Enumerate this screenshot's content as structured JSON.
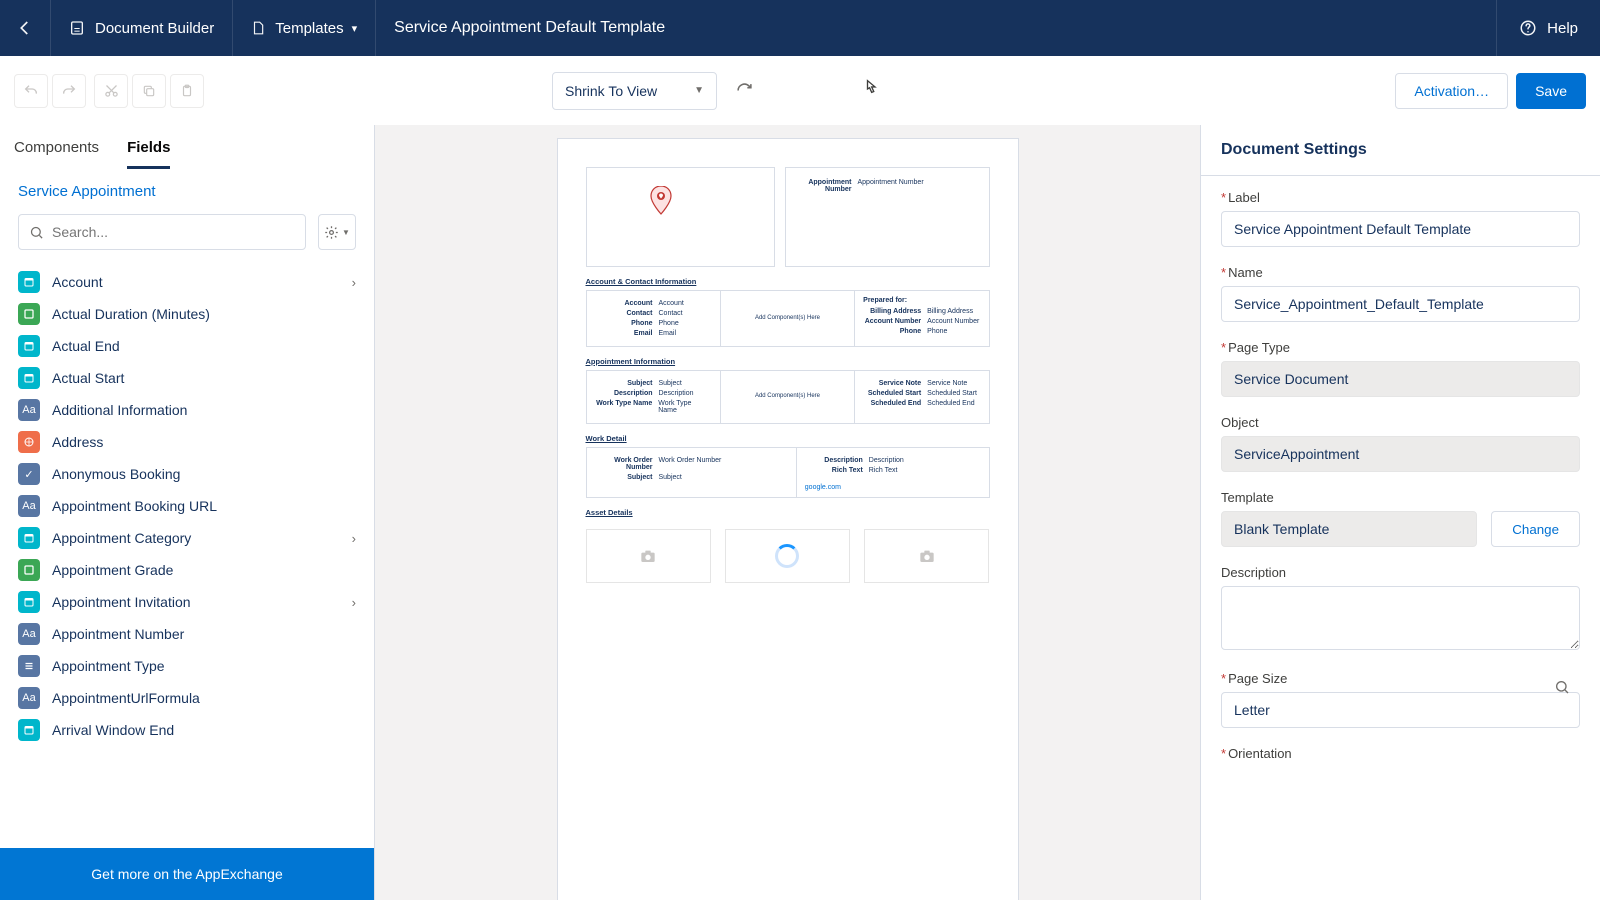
{
  "topbar": {
    "builder": "Document Builder",
    "templates": "Templates",
    "title": "Service Appointment Default Template",
    "help": "Help"
  },
  "toolbar": {
    "zoom": "Shrink To View",
    "activation": "Activation…",
    "save": "Save"
  },
  "left": {
    "tabs": {
      "components": "Components",
      "fields": "Fields"
    },
    "breadcrumb": "Service Appointment",
    "search_placeholder": "Search...",
    "fields": [
      {
        "label": "Account",
        "icon": "date",
        "chev": true
      },
      {
        "label": "Actual Duration (Minutes)",
        "icon": "num"
      },
      {
        "label": "Actual End",
        "icon": "date"
      },
      {
        "label": "Actual Start",
        "icon": "date"
      },
      {
        "label": "Additional Information",
        "icon": "textA"
      },
      {
        "label": "Address",
        "icon": "addr"
      },
      {
        "label": "Anonymous Booking",
        "icon": "check"
      },
      {
        "label": "Appointment Booking URL",
        "icon": "textA"
      },
      {
        "label": "Appointment Category",
        "icon": "date",
        "chev": true
      },
      {
        "label": "Appointment Grade",
        "icon": "num"
      },
      {
        "label": "Appointment Invitation",
        "icon": "date",
        "chev": true
      },
      {
        "label": "Appointment Number",
        "icon": "textA"
      },
      {
        "label": "Appointment Type",
        "icon": "list"
      },
      {
        "label": "AppointmentUrlFormula",
        "icon": "textA"
      },
      {
        "label": "Arrival Window End",
        "icon": "date"
      }
    ],
    "appexchange": "Get more on the AppExchange"
  },
  "canvas": {
    "header_kv": {
      "k": "Appointment Number",
      "v": "Appointment Number"
    },
    "sec1": {
      "title": "Account & Contact Information",
      "left": [
        [
          "Account",
          "Account"
        ],
        [
          "Contact",
          "Contact"
        ],
        [
          "Phone",
          "Phone"
        ],
        [
          "Email",
          "Email"
        ]
      ],
      "right_title": "Prepared for:",
      "right": [
        [
          "Billing Address",
          "Billing Address"
        ],
        [
          "Account Number",
          "Account Number"
        ],
        [
          "Phone",
          "Phone"
        ]
      ],
      "mid": "Add Component(s) Here"
    },
    "sec2": {
      "title": "Appointment Information",
      "left": [
        [
          "Subject",
          "Subject"
        ],
        [
          "Description",
          "Description"
        ],
        [
          "Work Type Name",
          "Work Type Name"
        ]
      ],
      "right": [
        [
          "Service Note",
          "Service Note"
        ],
        [
          "Scheduled Start",
          "Scheduled Start"
        ],
        [
          "Scheduled End",
          "Scheduled End"
        ]
      ],
      "mid": "Add Component(s) Here"
    },
    "sec3": {
      "title": "Work Detail",
      "left": [
        [
          "Work Order Number",
          "Work Order Number"
        ],
        [
          "Subject",
          "Subject"
        ]
      ],
      "right": [
        [
          "Description",
          "Description"
        ],
        [
          "Rich Text",
          "Rich Text"
        ]
      ],
      "link": "google.com"
    },
    "sec4": {
      "title": "Asset Details"
    }
  },
  "right": {
    "heading": "Document Settings",
    "label_lbl": "Label",
    "label_val": "Service Appointment Default Template",
    "name_lbl": "Name",
    "name_val": "Service_Appointment_Default_Template",
    "pagetype_lbl": "Page Type",
    "pagetype_val": "Service Document",
    "object_lbl": "Object",
    "object_val": "ServiceAppointment",
    "template_lbl": "Template",
    "template_val": "Blank Template",
    "change": "Change",
    "desc_lbl": "Description",
    "pagesize_lbl": "Page Size",
    "pagesize_val": "Letter",
    "orientation_lbl": "Orientation"
  }
}
